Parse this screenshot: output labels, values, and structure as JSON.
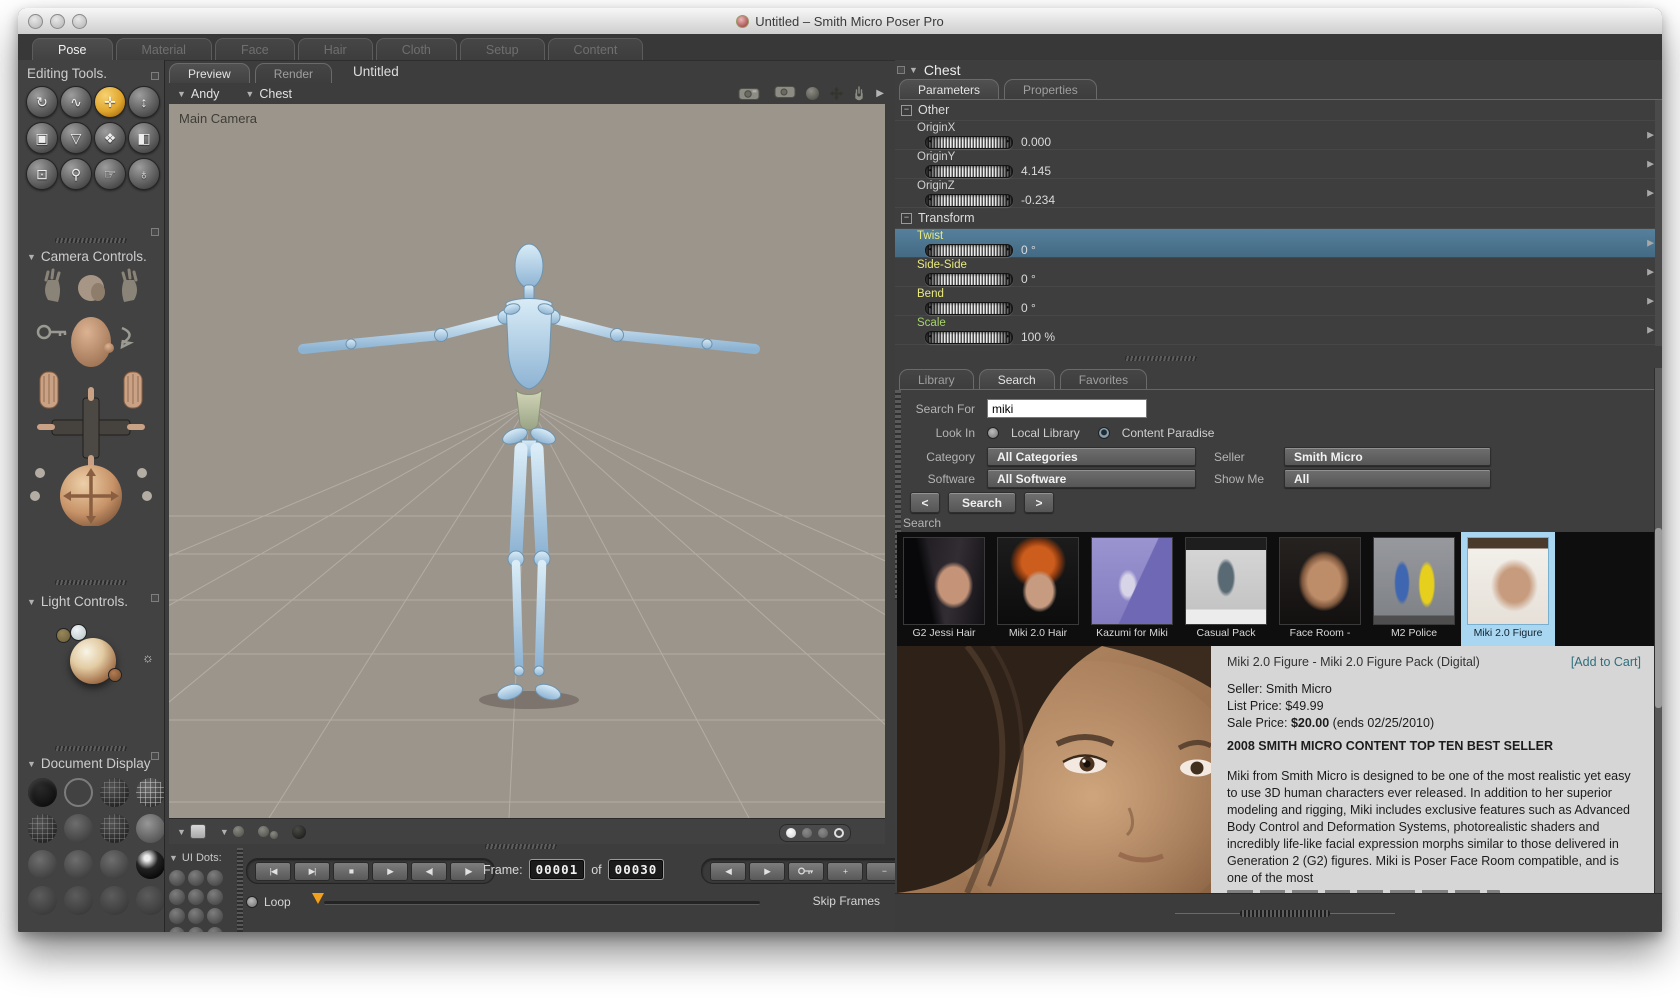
{
  "window": {
    "title": "Untitled – Smith Micro Poser Pro"
  },
  "room_tabs": [
    {
      "label": "Pose",
      "active": true
    },
    {
      "label": "Material",
      "active": false
    },
    {
      "label": "Face",
      "active": false
    },
    {
      "label": "Hair",
      "active": false
    },
    {
      "label": "Cloth",
      "active": false
    },
    {
      "label": "Setup",
      "active": false
    },
    {
      "label": "Content",
      "active": false
    }
  ],
  "sidebar": {
    "editing_tools": {
      "title": "Editing Tools.",
      "tools": [
        {
          "name": "rotate",
          "glyph": "↻",
          "active": false
        },
        {
          "name": "twist",
          "glyph": "∿",
          "active": false
        },
        {
          "name": "translate",
          "glyph": "✛",
          "active": true
        },
        {
          "name": "translate-in-out",
          "glyph": "↕",
          "active": false
        },
        {
          "name": "scale",
          "glyph": "▣",
          "active": false
        },
        {
          "name": "taper",
          "glyph": "▽",
          "active": false
        },
        {
          "name": "morph",
          "glyph": "❖",
          "active": false
        },
        {
          "name": "color",
          "glyph": "◧",
          "active": false
        },
        {
          "name": "chain-break",
          "glyph": "⊡",
          "active": false
        },
        {
          "name": "zoom",
          "glyph": "⚲",
          "active": false
        },
        {
          "name": "group",
          "glyph": "☞",
          "active": false
        },
        {
          "name": "view-magnifier",
          "glyph": "♁",
          "active": false
        }
      ]
    },
    "camera_controls": {
      "title": "Camera Controls."
    },
    "light_controls": {
      "title": "Light Controls."
    },
    "document_display": {
      "title": "Document Display",
      "styles": [
        "a",
        "b",
        "c",
        "d",
        "c",
        "e",
        "c",
        "f",
        "e",
        "e",
        "e",
        "g",
        "h",
        "h",
        "h",
        "h"
      ]
    }
  },
  "document": {
    "view_tabs": [
      {
        "label": "Preview",
        "active": true
      },
      {
        "label": "Render",
        "active": false
      }
    ],
    "title": "Untitled",
    "figure_menu": "Andy",
    "actor_menu": "Chest",
    "camera_label": "Main Camera"
  },
  "viewport_footer": {
    "circles": [
      "filled",
      "dim",
      "dim",
      "bright"
    ]
  },
  "timeline": {
    "ui_dots_label": "UI Dots:",
    "frame_label": "Frame:",
    "current_frame": "00001",
    "of_label": "of",
    "total_frames": "00030",
    "loop_label": "Loop",
    "skip_frames_label": "Skip Frames",
    "left_buttons": [
      {
        "name": "go-start",
        "glyph": "|◀"
      },
      {
        "name": "go-end",
        "glyph": "▶|"
      },
      {
        "name": "stop",
        "glyph": "■"
      },
      {
        "name": "play",
        "glyph": "▶"
      },
      {
        "name": "step-back",
        "glyph": "◀|"
      },
      {
        "name": "step-forward",
        "glyph": "|▶"
      }
    ],
    "right_buttons": [
      {
        "name": "prev-keyframe",
        "glyph": "◀"
      },
      {
        "name": "next-keyframe",
        "glyph": "▶"
      },
      {
        "name": "edit-keyframes",
        "glyph": "key"
      },
      {
        "name": "add-keyframe",
        "glyph": "+"
      },
      {
        "name": "delete-keyframe",
        "glyph": "−"
      }
    ]
  },
  "parameters": {
    "actor": "Chest",
    "tabs": [
      {
        "label": "Parameters",
        "active": true
      },
      {
        "label": "Properties",
        "active": false
      }
    ],
    "groups": [
      {
        "name": "Other",
        "params": [
          {
            "label": "OriginX",
            "value": "0.000",
            "color": "gray",
            "selected": false
          },
          {
            "label": "OriginY",
            "value": "4.145",
            "color": "gray",
            "selected": false
          },
          {
            "label": "OriginZ",
            "value": "-0.234",
            "color": "gray",
            "selected": false
          }
        ]
      },
      {
        "name": "Transform",
        "params": [
          {
            "label": "Twist",
            "value": "0 °",
            "color": "yellow",
            "selected": true
          },
          {
            "label": "Side-Side",
            "value": "0 °",
            "color": "yellow",
            "selected": false
          },
          {
            "label": "Bend",
            "value": "0 °",
            "color": "yellow",
            "selected": false
          },
          {
            "label": "Scale",
            "value": "100 %",
            "color": "green",
            "selected": false
          }
        ]
      }
    ]
  },
  "library": {
    "tabs": [
      {
        "label": "Library",
        "active": false
      },
      {
        "label": "Search",
        "active": true
      },
      {
        "label": "Favorites",
        "active": false
      }
    ],
    "form": {
      "search_for_label": "Search For",
      "search_value": "miki",
      "look_in_label": "Look In",
      "look_in_options": [
        {
          "label": "Local Library",
          "selected": false
        },
        {
          "label": "Content Paradise",
          "selected": true
        }
      ],
      "category_label": "Category",
      "category_value": "All Categories",
      "seller_label": "Seller",
      "seller_value": "Smith Micro",
      "software_label": "Software",
      "software_value": "All Software",
      "show_me_label": "Show Me",
      "show_me_value": "All",
      "prev_button": "<",
      "search_button": "Search",
      "next_button": ">"
    },
    "results_label": "Search",
    "results": [
      {
        "label": "G2 Jessi Hair",
        "selected": false
      },
      {
        "label": "Miki 2.0 Hair",
        "selected": false
      },
      {
        "label": "Kazumi for Miki",
        "selected": false
      },
      {
        "label": "Casual Pack",
        "selected": false
      },
      {
        "label": "Face Room -",
        "selected": false
      },
      {
        "label": "M2 Police",
        "selected": false
      },
      {
        "label": "Miki 2.0 Figure",
        "selected": true
      }
    ]
  },
  "product": {
    "title": "Miki 2.0 Figure - Miki 2.0 Figure Pack (Digital)",
    "add_to_cart": "[Add to Cart]",
    "seller": "Seller: Smith Micro",
    "list_price": "List Price: $49.99",
    "sale_price_label": "Sale Price:",
    "sale_price_value": "$20.00",
    "sale_price_ends": "(ends 02/25/2010)",
    "banner": "2008 SMITH MICRO CONTENT TOP TEN BEST SELLER",
    "description": "Miki from Smith Micro is designed to be one of the most realistic yet easy to use 3D human characters ever released. In addition to her superior modeling and rigging, Miki includes exclusive features such as Advanced Body Control and Deformation Systems, photorealistic shaders and incredibly life-like facial expression morphs similar to those delivered in Generation 2 (G2) figures. Miki is Poser Face Room compatible, and is one of the most"
  },
  "colors": {
    "selection_blue": "#4a7089",
    "param_yellow": "#e9e97e",
    "param_green": "#a5d36b",
    "tool_highlight_orange": "#e0a52c",
    "timeline_marker_orange": "#f0a020",
    "thumb_selected_bg": "#a9d7f2",
    "add_to_cart_teal": "#2e6e7e"
  }
}
